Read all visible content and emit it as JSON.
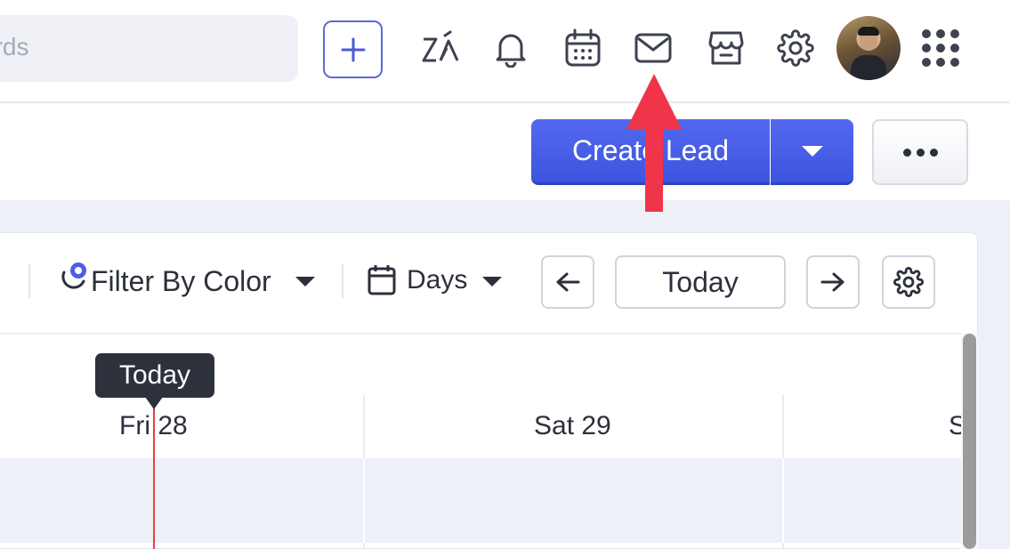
{
  "search": {
    "placeholder": "Search records",
    "visible_text": "ords"
  },
  "topbar": {
    "icons": [
      "plus-icon",
      "zia-icon",
      "bell-icon",
      "calendar-icon",
      "mail-icon",
      "marketplace-icon",
      "gear-icon",
      "avatar",
      "apps-grid-icon"
    ],
    "accent": "#5a6ad8"
  },
  "actions": {
    "create_lead_label": "Create Lead",
    "create_lead_color": "#4a5fe8"
  },
  "toolbar": {
    "filter_label": "Filter By Color",
    "days_label": "Days",
    "today_label": "Today"
  },
  "calendar": {
    "today_marker": "Today",
    "days": [
      "Fri 28",
      "Sat 29",
      "S"
    ],
    "today_line_color": "#e8413d"
  },
  "annotation": {
    "arrow_color": "#f0354a",
    "points_to": "mail-icon"
  }
}
